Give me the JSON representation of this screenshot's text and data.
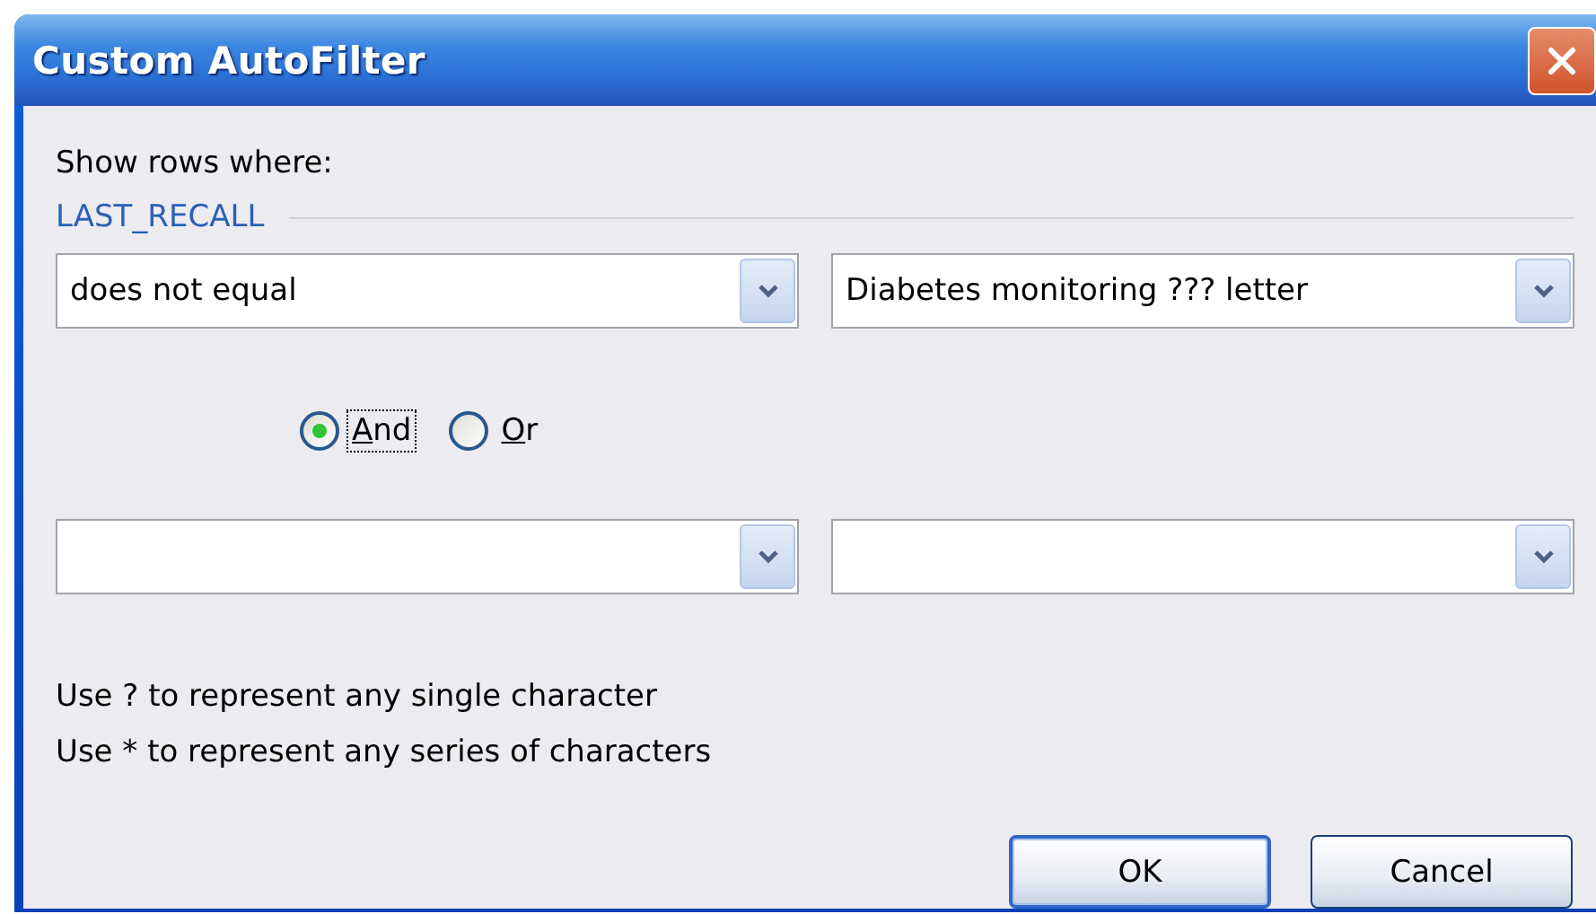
{
  "window": {
    "title": "Custom AutoFilter"
  },
  "intro": "Show rows where:",
  "field_label": "LAST_RECALL",
  "criteria": [
    {
      "kind": "filled",
      "operator": "does not equal",
      "value": "Diabetes monitoring ??? letter"
    },
    {
      "kind": "blank"
    }
  ],
  "logic": [
    {
      "label": "And",
      "selected": true,
      "focused": true
    },
    {
      "label": "Or",
      "selected": false,
      "focused": false
    }
  ],
  "hints": [
    "Use ? to represent any single character",
    "Use * to represent any series of characters"
  ],
  "buttons": [
    {
      "label": "OK",
      "default": true
    },
    {
      "label": "Cancel",
      "default": false
    }
  ]
}
